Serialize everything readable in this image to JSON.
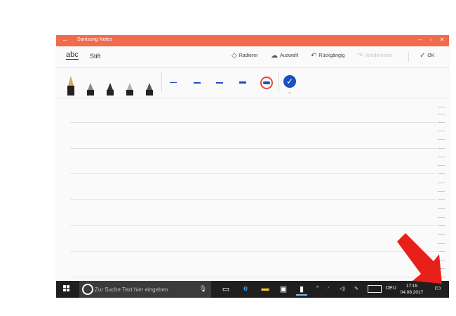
{
  "window": {
    "title": "Samsung Notes",
    "back_icon": "back-arrow-icon",
    "controls": [
      "minimize-icon",
      "restore-icon",
      "close-icon"
    ]
  },
  "toolbar": {
    "abc_label": "abc",
    "mode_label": "Stift",
    "eraser_label": "Radierer",
    "select_label": "Auswahl",
    "undo_label": "Rückgängig",
    "redo_label": "Wiederholen",
    "ok_label": "OK"
  },
  "pen_tools": {
    "pens": [
      "fountain-pen",
      "calligraphy-pen",
      "pencil",
      "marker",
      "brush-pen"
    ],
    "sizes": [
      "thin",
      "medium",
      "thick",
      "thicker",
      "thickest"
    ],
    "selected_color": "#1c4fbf",
    "accent": "#f26b4c"
  },
  "taskbar": {
    "search_placeholder": "Zur Suche Text hier eingeben",
    "language": "DEU",
    "time": "17:15",
    "date": "04.08.2017"
  }
}
